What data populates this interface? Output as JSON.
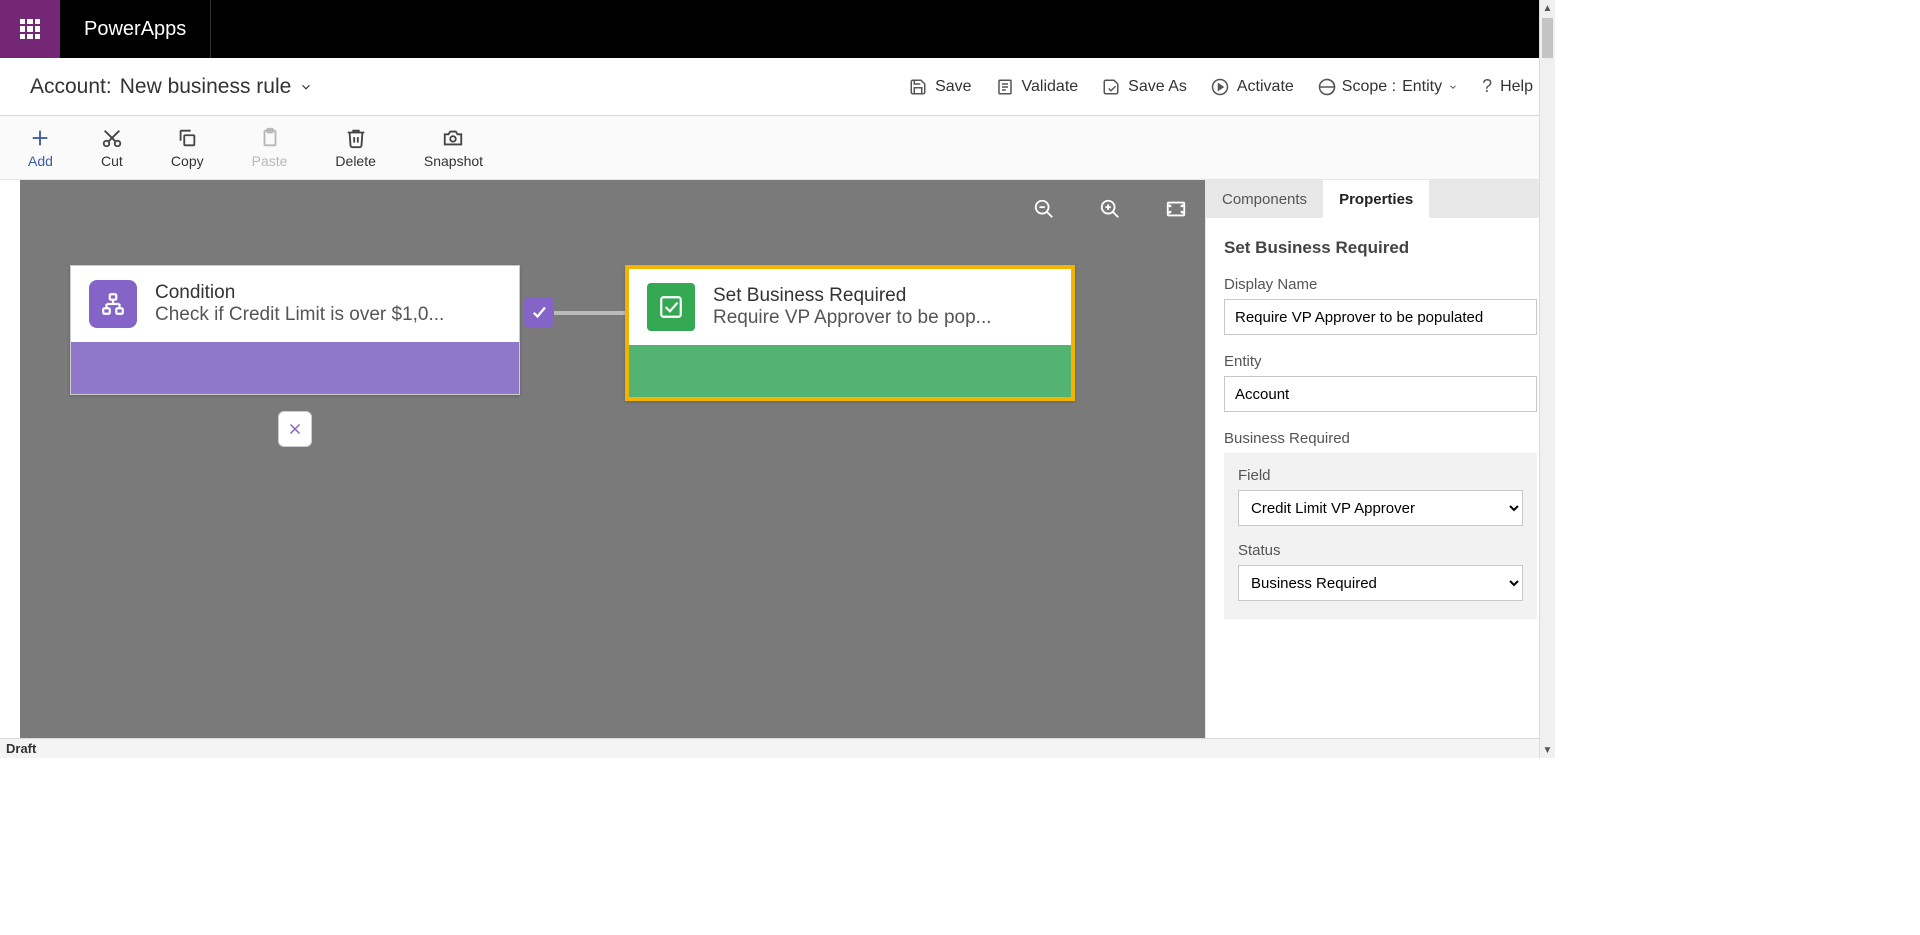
{
  "brand": "PowerApps",
  "page_title_prefix": "Account:",
  "page_title": "New business rule",
  "header_actions": {
    "save": "Save",
    "validate": "Validate",
    "save_as": "Save As",
    "activate": "Activate",
    "scope_label": "Scope :",
    "scope_value": "Entity",
    "help": "Help"
  },
  "toolbar": {
    "add": "Add",
    "cut": "Cut",
    "copy": "Copy",
    "paste": "Paste",
    "delete": "Delete",
    "snapshot": "Snapshot"
  },
  "canvas": {
    "condition": {
      "title": "Condition",
      "subtitle": "Check if Credit Limit is over $1,0..."
    },
    "action": {
      "title": "Set Business Required",
      "subtitle": "Require VP Approver to be pop..."
    }
  },
  "side": {
    "tab_components": "Components",
    "tab_properties": "Properties",
    "heading": "Set Business Required",
    "display_name_label": "Display Name",
    "display_name_value": "Require VP Approver to be populated",
    "entity_label": "Entity",
    "entity_value": "Account",
    "group_label": "Business Required",
    "field_label": "Field",
    "field_value": "Credit Limit VP Approver",
    "status_label": "Status",
    "status_value": "Business Required"
  },
  "status_bar": "Draft"
}
